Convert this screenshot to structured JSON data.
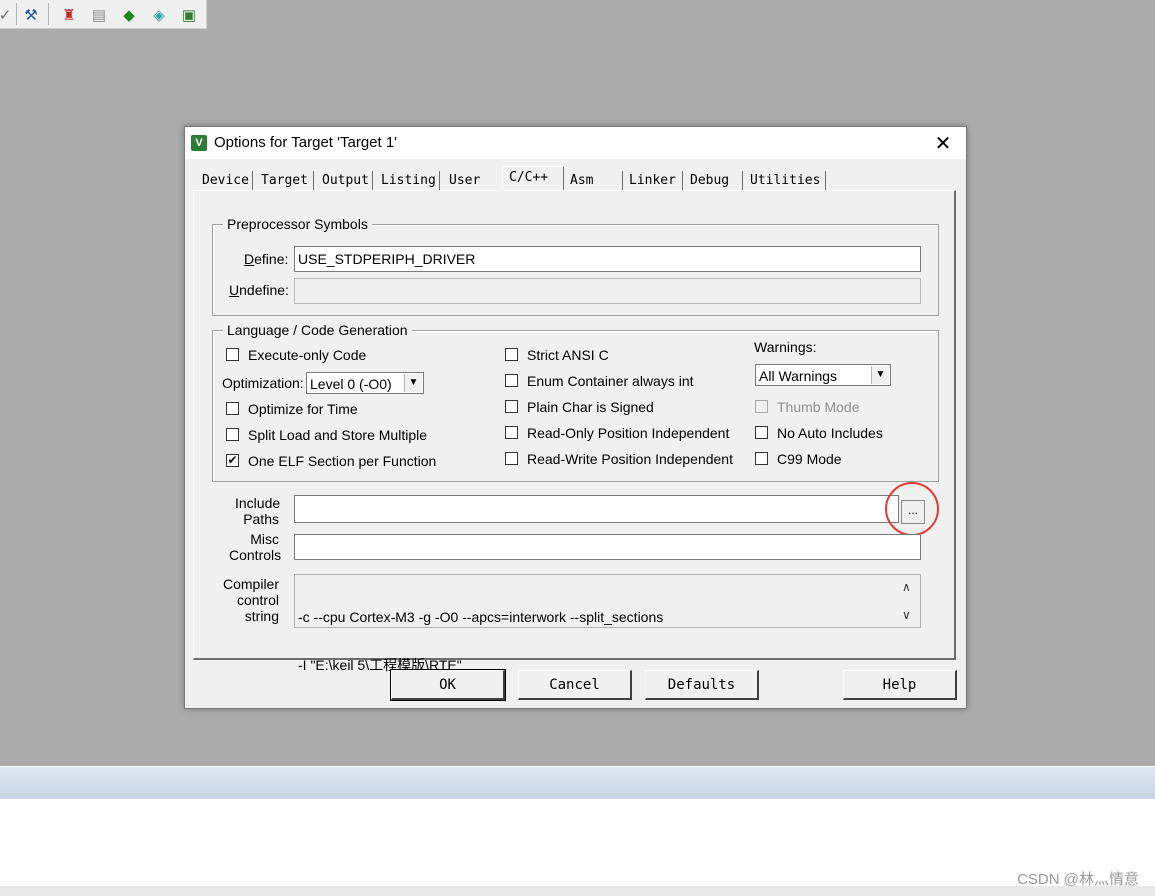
{
  "toolbar": {
    "icons": [
      "checkmark-icon",
      "magic-wand-icon",
      "build-target-icon",
      "batch-build-icon",
      "manage-components-icon",
      "pack-installer-icon",
      "select-device-icon"
    ]
  },
  "dialog": {
    "title": "Options for Target 'Target 1'",
    "close_glyph": "✕",
    "tabs": [
      "Device",
      "Target",
      "Output",
      "Listing",
      "User",
      "C/C++",
      "Asm",
      "Linker",
      "Debug",
      "Utilities"
    ],
    "active_tab": "C/C++",
    "preprocessor": {
      "legend": "Preprocessor Symbols",
      "define_label": "Define:",
      "define_value": "USE_STDPERIPH_DRIVER",
      "undefine_label": "Undefine:",
      "undefine_value": ""
    },
    "language": {
      "legend": "Language / Code Generation",
      "execute_only": {
        "label": "Execute-only Code",
        "checked": false
      },
      "optimization_label": "Optimization:",
      "optimization_value": "Level 0 (-O0)",
      "optimize_time": {
        "label": "Optimize for Time",
        "checked": false
      },
      "split_load": {
        "label": "Split Load and Store Multiple",
        "checked": false
      },
      "one_elf": {
        "label": "One ELF Section per Function",
        "checked": true
      },
      "strict_ansi": {
        "label": "Strict ANSI C",
        "checked": false
      },
      "enum_container": {
        "label": "Enum Container always int",
        "checked": false
      },
      "plain_char": {
        "label": "Plain Char is Signed",
        "checked": false
      },
      "ro_pi": {
        "label": "Read-Only Position Independent",
        "checked": false
      },
      "rw_pi": {
        "label": "Read-Write Position Independent",
        "checked": false
      },
      "warnings_label": "Warnings:",
      "warnings_value": "All Warnings",
      "thumb_mode": {
        "label": "Thumb Mode",
        "checked": false,
        "disabled": true
      },
      "no_auto_includes": {
        "label": "No Auto Includes",
        "checked": false
      },
      "c99_mode": {
        "label": "C99 Mode",
        "checked": false
      }
    },
    "include_paths": {
      "label_line1": "Include",
      "label_line2": "Paths",
      "value": "",
      "browse_label": "..."
    },
    "misc_controls": {
      "label_line1": "Misc",
      "label_line2": "Controls",
      "value": ""
    },
    "compiler_control": {
      "label_line1": "Compiler",
      "label_line2": "control",
      "label_line3": "string",
      "line1": "-c --cpu Cortex-M3 -g -O0 --apcs=interwork --split_sections",
      "line2": "-I \"E:\\keil 5\\工程模版\\RTE\""
    },
    "buttons": {
      "ok": "OK",
      "cancel": "Cancel",
      "defaults": "Defaults",
      "help": "Help"
    }
  },
  "highlight_color": "#e53935",
  "watermark": "CSDN @林灬情意"
}
